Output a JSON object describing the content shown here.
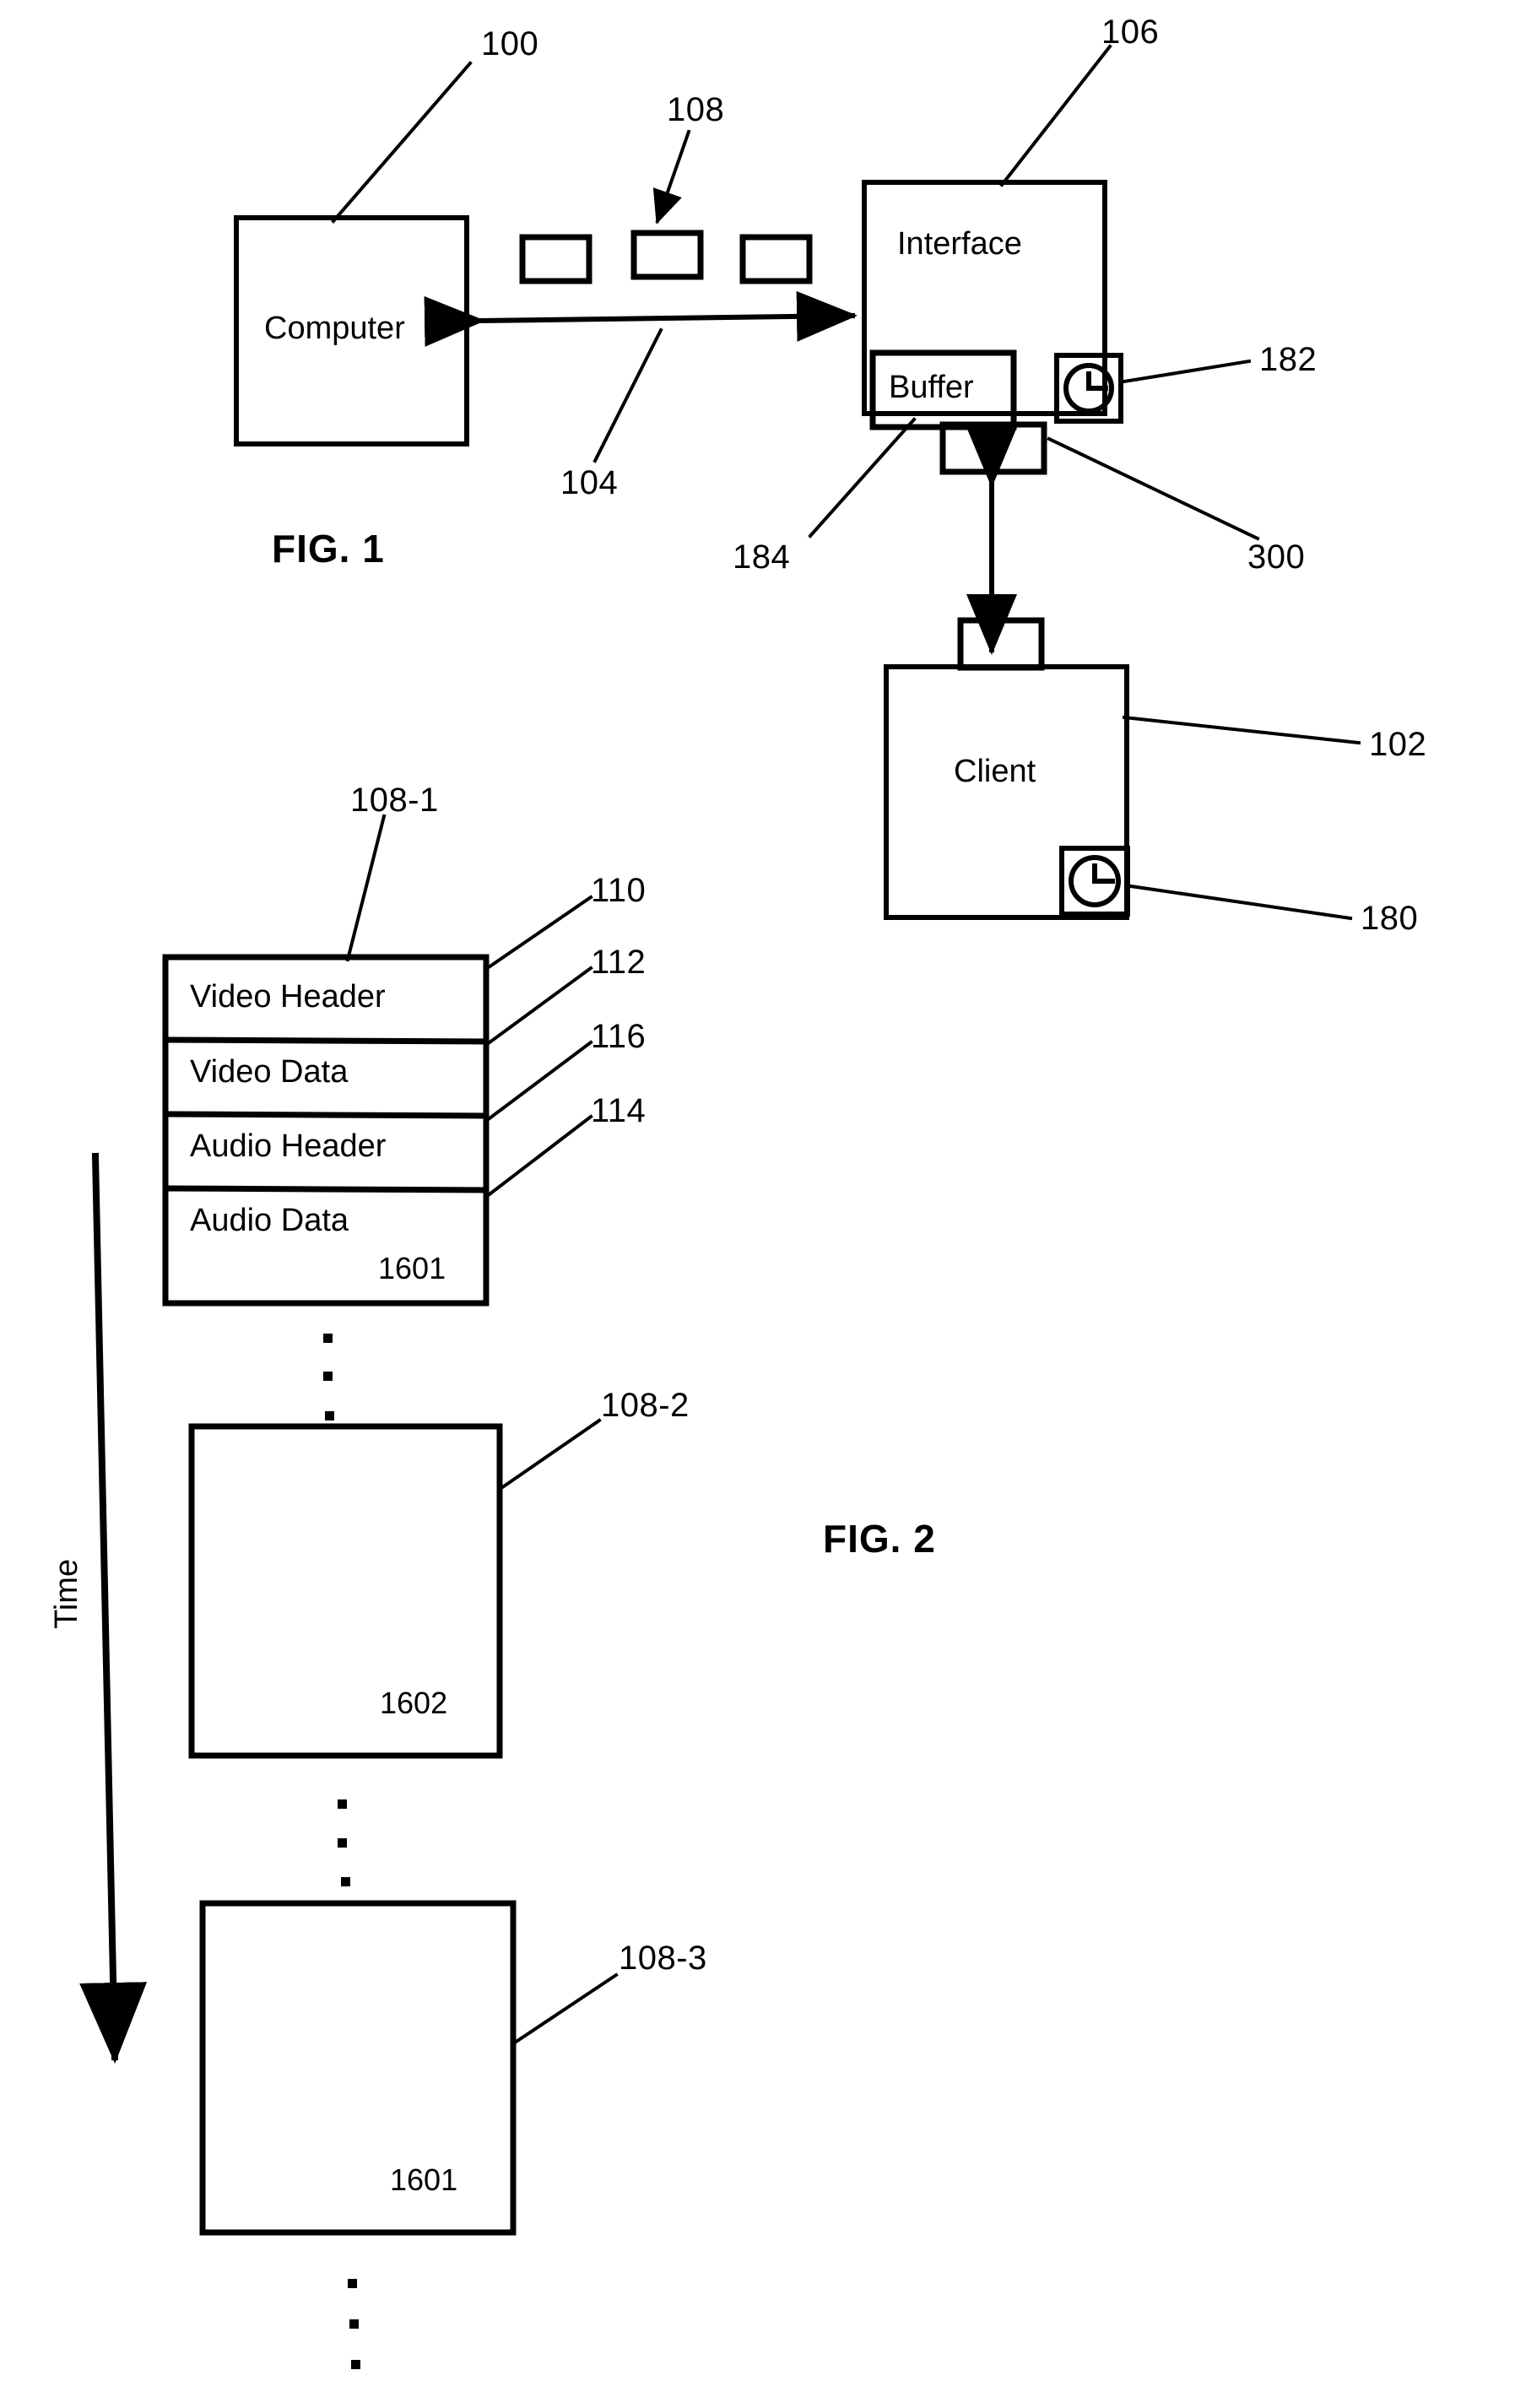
{
  "figure1": {
    "title": "FIG. 1",
    "blocks": {
      "computer": "Computer",
      "interface": "Interface",
      "buffer": "Buffer",
      "client": "Client"
    },
    "icons": {
      "interface_clock": "clock-icon",
      "client_clock": "clock-icon"
    },
    "refs": {
      "computer": "100",
      "packets": "108",
      "link": "104",
      "interface": "106",
      "interface_clock": "182",
      "buffer": "184",
      "connector": "300",
      "client": "102",
      "client_clock": "180"
    }
  },
  "figure2": {
    "title": "FIG. 2",
    "axis_label": "Time",
    "packet1": {
      "ref": "108-1",
      "fields": [
        {
          "label": "Video Header",
          "ref": "110"
        },
        {
          "label": "Video Data",
          "ref": "112"
        },
        {
          "label": "Audio Header",
          "ref": "116"
        },
        {
          "label": "Audio Data",
          "ref": "114"
        }
      ],
      "inner_ref": "1601"
    },
    "packet2": {
      "ref": "108-2",
      "inner_ref": "1602"
    },
    "packet3": {
      "ref": "108-3",
      "inner_ref": "1601"
    },
    "ellipsis": "•"
  },
  "colors": {
    "ink": "#000000",
    "paper": "#ffffff"
  }
}
